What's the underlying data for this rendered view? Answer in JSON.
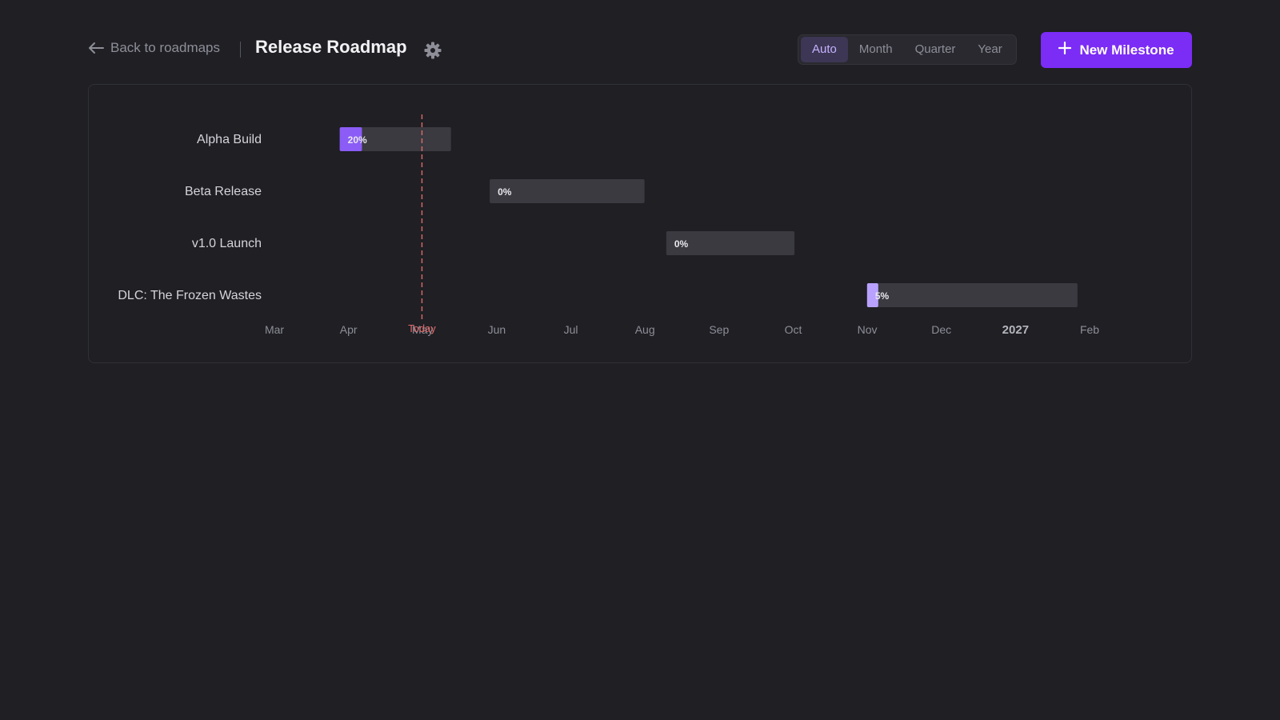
{
  "header": {
    "back_label": "Back to roadmaps",
    "title": "Release Roadmap",
    "view_options": [
      "Auto",
      "Month",
      "Quarter",
      "Year"
    ],
    "active_view": "Auto",
    "new_button_label": "New Milestone"
  },
  "chart_data": {
    "type": "gantt",
    "x_axis_ticks": [
      "Mar",
      "Apr",
      "May",
      "Jun",
      "Jul",
      "Aug",
      "Sep",
      "Oct",
      "Nov",
      "Dec",
      "2027",
      "Feb"
    ],
    "x_range": [
      "2026-03-01",
      "2027-02-01"
    ],
    "today": {
      "label": "Today",
      "date": "2026-05-01"
    },
    "milestones": [
      {
        "name": "Alpha Build",
        "start": "2026-03-28",
        "end": "2026-05-13",
        "progress": 20,
        "label": "20%"
      },
      {
        "name": "Beta Release",
        "start": "2026-05-29",
        "end": "2026-08-01",
        "progress": 0,
        "label": "0%"
      },
      {
        "name": "v1.0 Launch",
        "start": "2026-08-10",
        "end": "2026-10-02",
        "progress": 0,
        "label": "0%"
      },
      {
        "name": "DLC: The Frozen Wastes",
        "start": "2026-11-01",
        "end": "2027-01-27",
        "progress": 5,
        "label": "5%"
      }
    ]
  },
  "colors": {
    "accent": "#7b2cf5",
    "progress_fill": "#8b5cf6",
    "progress_fill_light": "#b9a1ff",
    "bar_track": "#3a3a40",
    "today_line": "#e06b6b"
  }
}
